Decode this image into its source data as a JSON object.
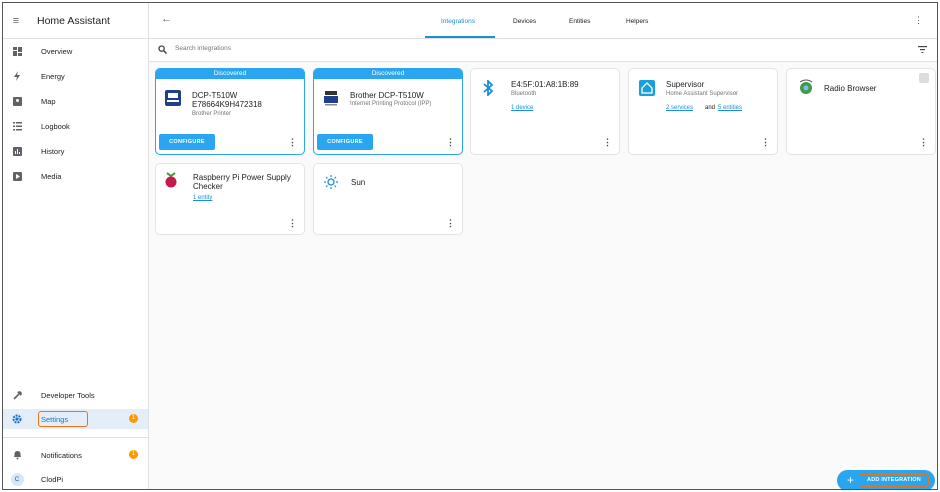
{
  "app": {
    "title": "Home Assistant"
  },
  "sidebar": {
    "items": [
      {
        "label": "Overview",
        "icon": "grid-icon"
      },
      {
        "label": "Energy",
        "icon": "lightning-icon"
      },
      {
        "label": "Map",
        "icon": "map-icon"
      },
      {
        "label": "Logbook",
        "icon": "list-icon"
      },
      {
        "label": "History",
        "icon": "chart-icon"
      },
      {
        "label": "Media",
        "icon": "play-icon"
      }
    ],
    "developer_tools": "Developer Tools",
    "settings": {
      "label": "Settings",
      "badge": "1"
    },
    "notifications": {
      "label": "Notifications",
      "badge": "1"
    },
    "user": {
      "name": "ClodPi",
      "initial": "C"
    }
  },
  "tabs": [
    "Integrations",
    "Devices",
    "Entities",
    "Helpers"
  ],
  "search": {
    "placeholder": "Search integrations"
  },
  "cards": {
    "dcp": {
      "band": "Discovered",
      "title_line1": "DCP-T510W",
      "title_line2": "E78664K9H472318",
      "subtitle": "Brother Printer",
      "configure": "CONFIGURE"
    },
    "brother": {
      "band": "Discovered",
      "title": "Brother DCP-T510W",
      "subtitle": "Internet Printing Protocol (IPP)",
      "configure": "CONFIGURE"
    },
    "bluetooth": {
      "title": "E4:5F:01:A8:1B:89",
      "subtitle": "Bluetooth",
      "link": "1 device"
    },
    "supervisor": {
      "title": "Supervisor",
      "subtitle": "Home Assistant Supervisor",
      "link1": "2 services",
      "and": "and",
      "link2": "5 entities"
    },
    "radio": {
      "title": "Radio Browser"
    },
    "rpi": {
      "title_line1": "Raspberry Pi Power Supply",
      "title_line2": "Checker",
      "link": "1 entity"
    },
    "sun": {
      "title": "Sun"
    }
  },
  "fab": {
    "label": "ADD INTEGRATION"
  },
  "colors": {
    "accent": "#2aa5f0",
    "highlight": "#e8731a",
    "badge": "#ff9800"
  }
}
